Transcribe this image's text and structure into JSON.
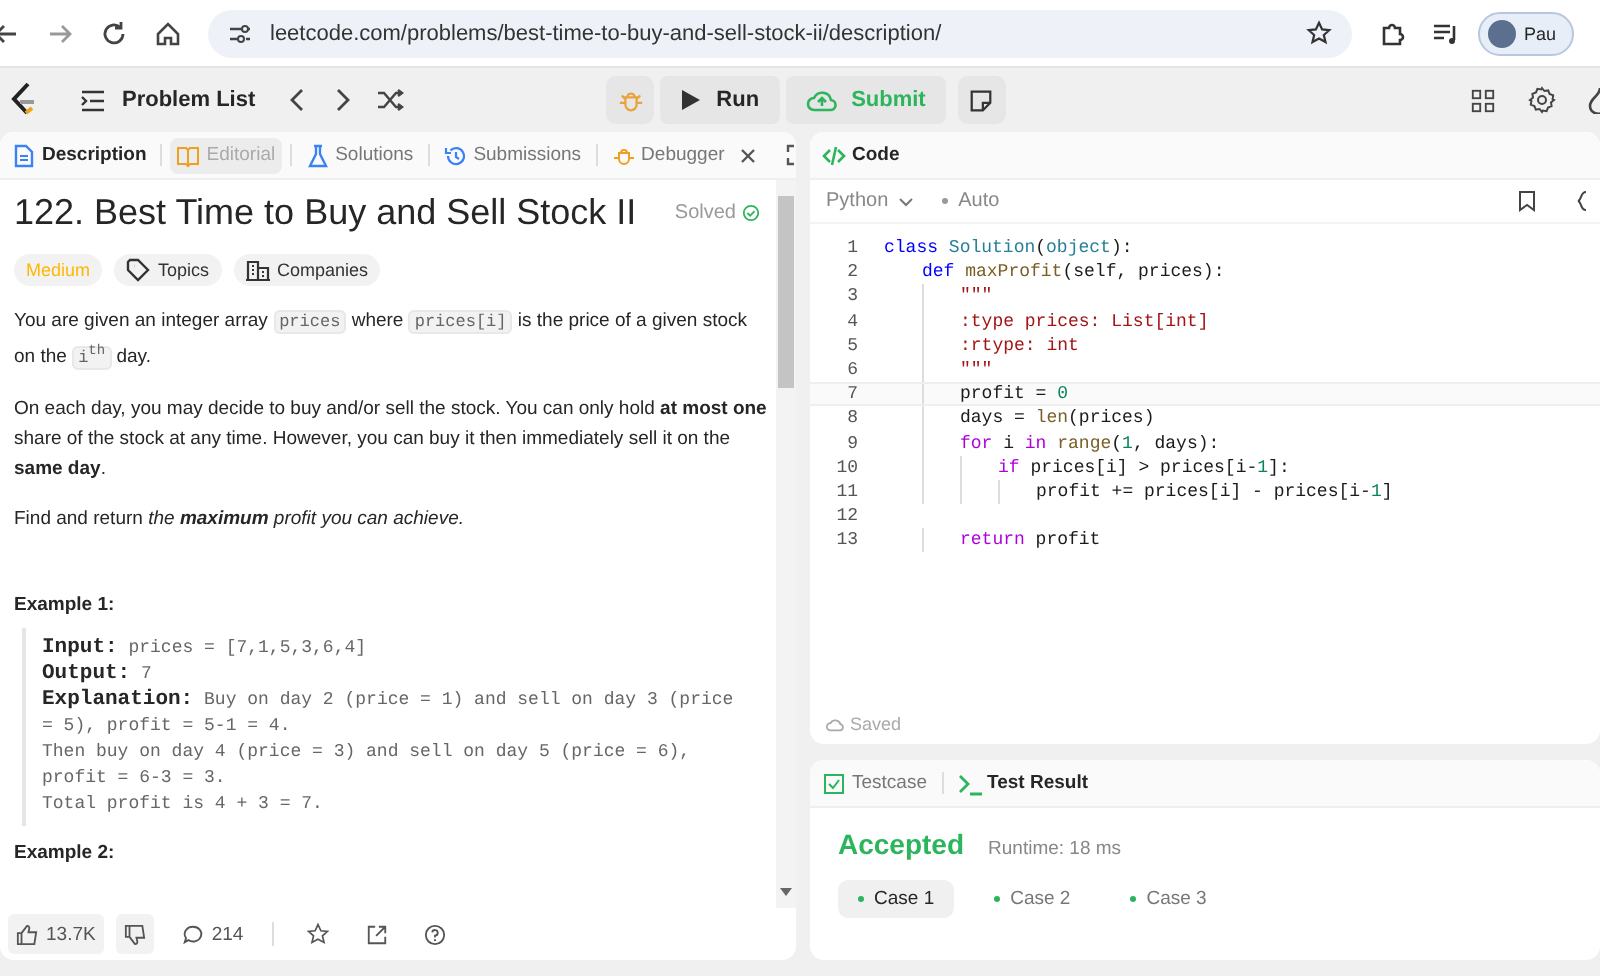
{
  "browser": {
    "url": "leetcode.com/problems/best-time-to-buy-and-sell-stock-ii/description/",
    "profile": "Pau"
  },
  "navbar": {
    "problem_list": "Problem List",
    "run": "Run",
    "submit": "Submit"
  },
  "left_tabs": [
    {
      "label": "Description",
      "selected": true,
      "locked": false,
      "closable": false
    },
    {
      "label": "Editorial",
      "selected": false,
      "locked": true,
      "closable": false
    },
    {
      "label": "Solutions",
      "selected": false,
      "locked": false,
      "closable": false
    },
    {
      "label": "Submissions",
      "selected": false,
      "locked": false,
      "closable": false
    },
    {
      "label": "Debugger",
      "selected": false,
      "locked": false,
      "closable": true
    }
  ],
  "problem": {
    "title": "122. Best Time to Buy and Sell Stock II",
    "status": "Solved",
    "difficulty": "Medium",
    "tags": [
      "Topics",
      "Companies"
    ],
    "paragraphs": [
      [
        {
          "kind": "text",
          "text": "You are given an integer array "
        },
        {
          "kind": "code",
          "text": "prices"
        },
        {
          "kind": "text",
          "text": " where "
        },
        {
          "kind": "code",
          "text": "prices[i]"
        },
        {
          "kind": "text",
          "text": " is the price of a given stock on the "
        },
        {
          "kind": "code",
          "text": "i$^{th}$"
        },
        {
          "kind": "text",
          "text": " day."
        }
      ],
      [
        {
          "kind": "text",
          "text": "On each day, you may decide to buy and/or sell the stock. You can only hold **at most one** share of the stock at any time. However, you can buy it then immediately sell it on the **same day**."
        }
      ],
      [
        {
          "kind": "text",
          "text": "Find and return "
        },
        {
          "kind": "italic",
          "text": "the **maximum** profit you can achieve."
        }
      ]
    ],
    "examples": [
      {
        "heading": "Example 1:",
        "lines": [
          "**Input:** prices = [7,1,5,3,6,4]",
          "**Output:** 7",
          "**Explanation:** Buy on day 2 (price = 1) and sell on day 3 (price = 5), profit = 5-1 = 4.",
          "Then buy on day 4 (price = 3) and sell on day 5 (price = 6), profit = 6-3 = 3.",
          "Total profit is 4 + 3 = 7."
        ]
      },
      {
        "heading": "Example 2:"
      }
    ],
    "likes": "13.7K",
    "comments": "214"
  },
  "editor": {
    "title": "Code",
    "language": "Python",
    "mode": "Auto",
    "saved": "Saved",
    "lines": [
      {
        "number": "1",
        "current": false,
        "tokens": [
          {
            "kind": "keyword",
            "text": "class"
          },
          {
            "kind": "type",
            "text": " Solution"
          },
          {
            "kind": "plain",
            "text": "("
          },
          {
            "kind": "type",
            "text": "object"
          },
          {
            "kind": "plain",
            "text": "):"
          }
        ]
      },
      {
        "number": "2",
        "current": false,
        "tokens": [
          {
            "kind": "keyword",
            "text": "    def"
          },
          {
            "kind": "function",
            "text": " maxProfit"
          },
          {
            "kind": "plain",
            "text": "(self, prices):"
          }
        ]
      },
      {
        "number": "3",
        "current": false,
        "tokens": [
          {
            "kind": "string",
            "text": "        \"\"\""
          }
        ]
      },
      {
        "number": "4",
        "current": false,
        "tokens": [
          {
            "kind": "string",
            "text": "        :type prices: List[int]"
          }
        ]
      },
      {
        "number": "5",
        "current": false,
        "tokens": [
          {
            "kind": "string",
            "text": "        :rtype: int"
          }
        ]
      },
      {
        "number": "6",
        "current": false,
        "tokens": [
          {
            "kind": "string",
            "text": "        \"\"\""
          }
        ]
      },
      {
        "number": "7",
        "current": true,
        "tokens": [
          {
            "kind": "plain",
            "text": "        profit = "
          },
          {
            "kind": "number",
            "text": "0"
          }
        ]
      },
      {
        "number": "8",
        "current": false,
        "tokens": [
          {
            "kind": "plain",
            "text": "        days = "
          },
          {
            "kind": "function",
            "text": "len"
          },
          {
            "kind": "plain",
            "text": "(prices)"
          }
        ]
      },
      {
        "number": "9",
        "current": false,
        "tokens": [
          {
            "kind": "control",
            "text": "        for"
          },
          {
            "kind": "plain",
            "text": " i "
          },
          {
            "kind": "control",
            "text": "in"
          },
          {
            "kind": "function",
            "text": " range"
          },
          {
            "kind": "plain",
            "text": "("
          },
          {
            "kind": "number",
            "text": "1"
          },
          {
            "kind": "plain",
            "text": ", days):"
          }
        ]
      },
      {
        "number": "10",
        "current": false,
        "tokens": [
          {
            "kind": "control",
            "text": "            if"
          },
          {
            "kind": "plain",
            "text": " prices[i] > prices[i-"
          },
          {
            "kind": "number",
            "text": "1"
          },
          {
            "kind": "plain",
            "text": "]:"
          }
        ]
      },
      {
        "number": "11",
        "current": false,
        "tokens": [
          {
            "kind": "plain",
            "text": "                profit += prices[i] - prices[i-"
          },
          {
            "kind": "number",
            "text": "1"
          },
          {
            "kind": "plain",
            "text": "]"
          }
        ]
      },
      {
        "number": "12",
        "current": false
      },
      {
        "number": "13",
        "current": false,
        "tokens": [
          {
            "kind": "control",
            "text": "        return"
          },
          {
            "kind": "plain",
            "text": " profit"
          }
        ]
      }
    ]
  },
  "result_tabs": [
    {
      "label": "Testcase",
      "selected": false
    },
    {
      "label": "Test Result",
      "selected": true
    }
  ],
  "result": {
    "verdict": "Accepted",
    "runtime": "Runtime: 18 ms",
    "cases": [
      {
        "label": "Case 1",
        "selected": true
      },
      {
        "label": "Case 2",
        "selected": false
      },
      {
        "label": "Case 3",
        "selected": false
      }
    ]
  }
}
